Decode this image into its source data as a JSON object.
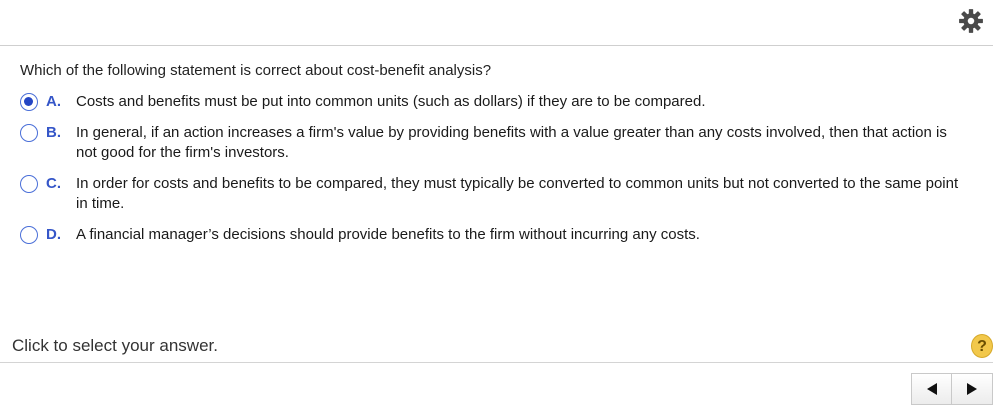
{
  "header": {
    "settings_icon": "gear-icon"
  },
  "question": {
    "text": "Which of the following statement is correct about cost-benefit analysis?",
    "selected": "A",
    "options": [
      {
        "letter": "A.",
        "text": "Costs and benefits must be put into common units (such as dollars) if they are to be compared."
      },
      {
        "letter": "B.",
        "text": "In general, if an action increases a firm's value by providing benefits with a value greater than any costs involved, then that action is not good for the firm's investors."
      },
      {
        "letter": "C.",
        "text": "In order for costs and benefits to be compared, they must typically be converted to common units but not converted to the same point in time."
      },
      {
        "letter": "D.",
        "text": "A financial manager’s decisions should provide benefits to the firm without incurring any costs."
      }
    ]
  },
  "footer": {
    "instruction": "Click to select your answer.",
    "help_label": "?",
    "prev_icon": "triangle-left-icon",
    "next_icon": "triangle-right-icon"
  },
  "colors": {
    "accent": "#3556c8",
    "help_bg": "#f2c84b"
  }
}
